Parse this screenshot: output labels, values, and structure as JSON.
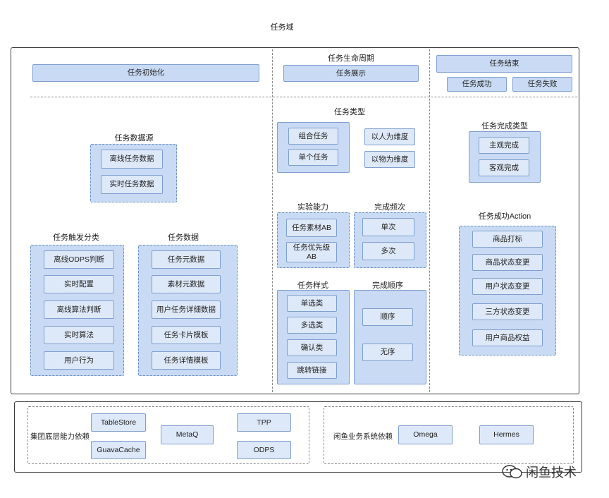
{
  "page_title": "任务域",
  "sections": {
    "init": "任务初始化",
    "lifecycle": "任务生命周期",
    "show": "任务展示",
    "end": "任务结束",
    "success": "任务成功",
    "fail": "任务失败"
  },
  "data_source": {
    "title": "任务数据源",
    "items": [
      "离线任务数据",
      "实时任务数据"
    ]
  },
  "trigger": {
    "title": "任务触发分类",
    "items": [
      "离线ODPS判断",
      "实时配置",
      "离线算法判断",
      "实时算法",
      "用户行为"
    ]
  },
  "task_data": {
    "title": "任务数据",
    "items": [
      "任务元数据",
      "素材元数据",
      "用户任务详细数据",
      "任务卡片模板",
      "任务详情模板"
    ]
  },
  "task_type": {
    "title": "任务类型",
    "left": [
      "组合任务",
      "单个任务"
    ],
    "right": [
      "以人为维度",
      "以物为维度"
    ]
  },
  "experiment": {
    "title": "实验能力",
    "items": [
      "任务素材AB",
      "任务优先级\nAB"
    ]
  },
  "frequency": {
    "title": "完成频次",
    "items": [
      "单次",
      "多次"
    ]
  },
  "style": {
    "title": "任务样式",
    "items": [
      "单选类",
      "多选类",
      "确认类",
      "跳转链接"
    ]
  },
  "order": {
    "title": "完成顺序",
    "items": [
      "顺序",
      "无序"
    ]
  },
  "complete_type": {
    "title": "任务完成类型",
    "items": [
      "主观完成",
      "客观完成"
    ]
  },
  "success_action": {
    "title": "任务成功Action",
    "items": [
      "商品打标",
      "商品状态变更",
      "用户状态变更",
      "三方状态变更",
      "用户商品权益"
    ]
  },
  "group_deps": {
    "label": "集团底层能力依赖",
    "items": [
      "TableStore",
      "GuavaCache",
      "MetaQ",
      "TPP",
      "ODPS"
    ]
  },
  "xianyu_deps": {
    "label": "闲鱼业务系统依赖",
    "items": [
      "Omega",
      "Hermes"
    ]
  },
  "watermark": "闲鱼技术"
}
